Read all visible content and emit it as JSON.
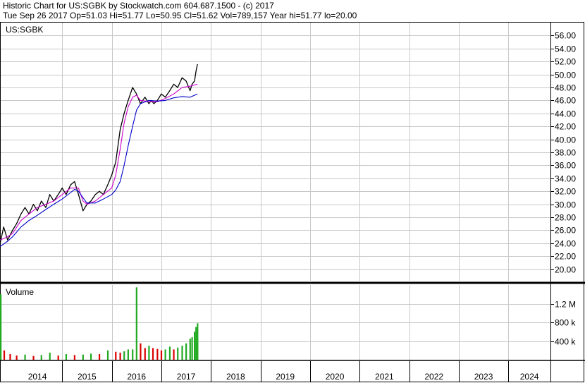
{
  "header": {
    "title_line": "Historic Chart for US:SGBK by Stockwatch.com 604.687.1500 - (c) 2017",
    "quote_line": "Tue Sep 26 2017   Op=51.03   Hi=51.77   Lo=50.95   Cl=51.62   Vol=789,157   Year hi=51.77   lo=20.00"
  },
  "chart_data": {
    "type": "line",
    "symbol_label": "US:SGBK",
    "volume_label": "Volume",
    "price": {
      "ylim": [
        18,
        58
      ],
      "yticks": [
        "20.00",
        "22.00",
        "24.00",
        "26.00",
        "28.00",
        "30.00",
        "32.00",
        "34.00",
        "36.00",
        "38.00",
        "40.00",
        "42.00",
        "44.00",
        "46.00",
        "48.00",
        "50.00",
        "52.00",
        "54.00",
        "56.00"
      ],
      "series": [
        {
          "key": "close",
          "color": "#000000",
          "x": [
            2013.75,
            2013.82,
            2013.9,
            2014.0,
            2014.08,
            2014.17,
            2014.25,
            2014.33,
            2014.42,
            2014.5,
            2014.58,
            2014.67,
            2014.75,
            2014.83,
            2014.92,
            2015.0,
            2015.08,
            2015.17,
            2015.25,
            2015.33,
            2015.42,
            2015.5,
            2015.58,
            2015.67,
            2015.75,
            2015.83,
            2015.92,
            2016.0,
            2016.08,
            2016.17,
            2016.25,
            2016.33,
            2016.42,
            2016.5,
            2016.58,
            2016.67,
            2016.75,
            2016.8,
            2016.85,
            2016.92,
            2017.0,
            2017.08,
            2017.17,
            2017.25,
            2017.33,
            2017.42,
            2017.5,
            2017.58,
            2017.62,
            2017.67,
            2017.7,
            2017.73
          ],
          "y": [
            24.0,
            26.5,
            24.5,
            26.0,
            27.0,
            28.5,
            29.5,
            28.5,
            30.0,
            29.0,
            30.5,
            29.5,
            31.5,
            30.5,
            31.5,
            32.5,
            31.5,
            33.0,
            33.5,
            31.5,
            29.0,
            30.0,
            30.5,
            31.5,
            32.0,
            31.5,
            33.0,
            34.5,
            36.5,
            41.5,
            44.0,
            46.0,
            48.0,
            47.0,
            45.5,
            46.5,
            45.5,
            46.0,
            45.5,
            46.0,
            47.0,
            46.5,
            47.5,
            48.5,
            48.0,
            49.5,
            49.0,
            47.5,
            48.5,
            49.0,
            50.5,
            51.6
          ]
        },
        {
          "key": "ma-short",
          "color": "#cc00cc",
          "x": [
            2013.75,
            2013.9,
            2014.0,
            2014.17,
            2014.33,
            2014.5,
            2014.67,
            2014.83,
            2015.0,
            2015.17,
            2015.33,
            2015.42,
            2015.5,
            2015.67,
            2015.83,
            2016.0,
            2016.08,
            2016.17,
            2016.25,
            2016.33,
            2016.42,
            2016.5,
            2016.58,
            2016.75,
            2016.92,
            2017.08,
            2017.25,
            2017.42,
            2017.58,
            2017.73
          ],
          "y": [
            24.5,
            25.0,
            25.5,
            27.5,
            28.5,
            29.5,
            30.0,
            30.5,
            31.5,
            32.5,
            32.5,
            30.5,
            30.0,
            30.5,
            31.5,
            32.5,
            34.5,
            38.5,
            42.5,
            45.0,
            46.5,
            46.8,
            46.0,
            45.8,
            45.8,
            46.3,
            47.0,
            48.0,
            48.2,
            48.5
          ]
        },
        {
          "key": "ma-long",
          "color": "#0000cc",
          "x": [
            2013.75,
            2013.9,
            2014.0,
            2014.17,
            2014.33,
            2014.5,
            2014.67,
            2014.83,
            2015.0,
            2015.17,
            2015.25,
            2015.33,
            2015.42,
            2015.5,
            2015.67,
            2015.83,
            2016.0,
            2016.08,
            2016.17,
            2016.25,
            2016.33,
            2016.42,
            2016.5,
            2016.58,
            2016.75,
            2016.92,
            2017.08,
            2017.25,
            2017.42,
            2017.58,
            2017.73
          ],
          "y": [
            23.5,
            24.3,
            25.0,
            26.5,
            27.5,
            28.3,
            29.2,
            30.0,
            30.8,
            31.8,
            32.3,
            32.0,
            31.0,
            30.2,
            30.2,
            30.8,
            31.5,
            32.2,
            33.5,
            36.0,
            39.0,
            42.0,
            44.5,
            45.5,
            46.0,
            45.9,
            46.0,
            46.4,
            46.6,
            46.5,
            47.0
          ]
        }
      ]
    },
    "volume": {
      "ylim": [
        0,
        1600000
      ],
      "yticks": [
        "400 k",
        "800 k",
        "1.2 M"
      ],
      "x": [
        2013.76,
        2013.83,
        2013.95,
        2014.08,
        2014.25,
        2014.42,
        2014.58,
        2014.75,
        2014.92,
        2015.08,
        2015.25,
        2015.42,
        2015.58,
        2015.75,
        2015.92,
        2016.08,
        2016.17,
        2016.25,
        2016.33,
        2016.42,
        2016.5,
        2016.58,
        2016.67,
        2016.75,
        2016.83,
        2016.92,
        2017.0,
        2017.08,
        2017.17,
        2017.25,
        2017.33,
        2017.42,
        2017.5,
        2017.58,
        2017.62,
        2017.67,
        2017.7,
        2017.73
      ],
      "values": [
        1400000,
        200000,
        120000,
        90000,
        110000,
        80000,
        100000,
        150000,
        90000,
        120000,
        100000,
        110000,
        130000,
        120000,
        200000,
        170000,
        150000,
        180000,
        220000,
        220000,
        1550000,
        350000,
        250000,
        300000,
        250000,
        230000,
        200000,
        220000,
        280000,
        220000,
        260000,
        300000,
        350000,
        450000,
        480000,
        600000,
        700000,
        780000
      ]
    },
    "x_axis": {
      "xlim": [
        2013.76,
        2024.85
      ],
      "tick_labels": [
        "2014",
        "2015",
        "2016",
        "2017",
        "2018",
        "2019",
        "2020",
        "2021",
        "2022",
        "2023",
        "2024"
      ]
    },
    "grid": true
  }
}
